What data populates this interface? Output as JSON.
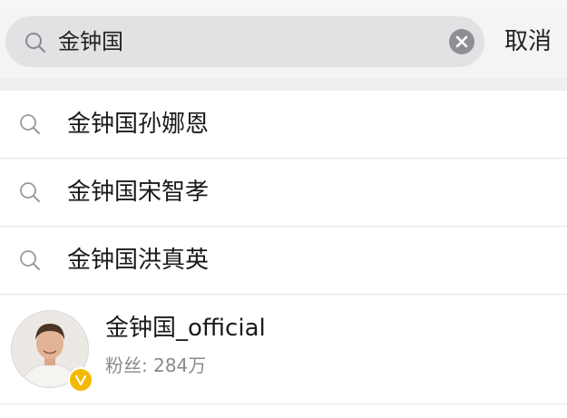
{
  "search": {
    "query": "金钟国",
    "cancel_label": "取消"
  },
  "suggestions": [
    {
      "label": "金钟国孙娜恩"
    },
    {
      "label": "金钟国宋智孝"
    },
    {
      "label": "金钟国洪真英"
    }
  ],
  "user_result": {
    "name": "金钟国_official",
    "fans_label": "粉丝:",
    "fans_count": "284万",
    "verified": true
  },
  "icons": {
    "search": "search-icon",
    "clear": "clear-icon",
    "verified": "verified-badge-icon"
  },
  "colors": {
    "verified_badge": "#f5b800",
    "search_box_bg": "#e2e2e4"
  }
}
